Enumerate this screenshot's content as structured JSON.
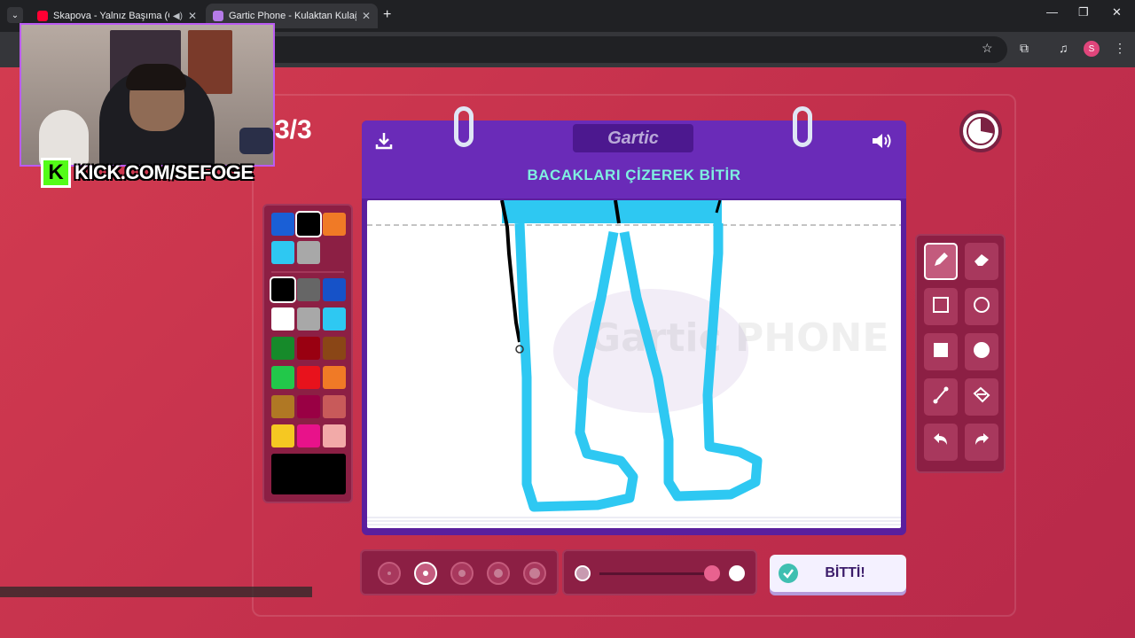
{
  "browser": {
    "tabs": [
      {
        "title": "Skapova - Yalnız Başıma (O",
        "active": false,
        "favicon_color": "#ff0033"
      },
      {
        "title": "Gartic Phone - Kulaktan Kulağa",
        "active": true,
        "favicon_color": "#b57be8"
      }
    ],
    "profile_initial": "S",
    "icons": [
      "tab-search-icon",
      "new-tab-icon",
      "minimize-icon",
      "restore-icon",
      "close-icon",
      "bookmark-star-icon",
      "extensions-icon",
      "media-control-icon",
      "menu-icon"
    ]
  },
  "stream": {
    "kick_badge": "KICK.COM/SEFOGE",
    "kick_logo": "K"
  },
  "game": {
    "round": "3/3",
    "logo": "Gartic",
    "instruction": "BACAKLARI ÇİZEREK BİTİR",
    "watermark": "Gartic PHONE",
    "done_label": "BİTTİ!",
    "timer_remaining_fraction": 0.72
  },
  "palette": {
    "recent": [
      "#1a5fd6",
      "#000000",
      "#f07a26",
      "#2ec8f2",
      "#a8a8a8"
    ],
    "selected_recent_index": 1,
    "colors": [
      "#000000",
      "#666666",
      "#1652c8",
      "#ffffff",
      "#a8a8a8",
      "#2ec8f2",
      "#168a2a",
      "#990011",
      "#8a4616",
      "#22c84a",
      "#e8121c",
      "#f07a26",
      "#b07824",
      "#990044",
      "#c85a5a",
      "#f5c822",
      "#e8128a",
      "#f2aaa8"
    ],
    "current": "#000000"
  },
  "tools": [
    {
      "name": "pencil",
      "selected": true
    },
    {
      "name": "eraser",
      "selected": false
    },
    {
      "name": "rectangle-outline",
      "selected": false
    },
    {
      "name": "ellipse-outline",
      "selected": false
    },
    {
      "name": "rectangle-fill",
      "selected": false
    },
    {
      "name": "ellipse-fill",
      "selected": false
    },
    {
      "name": "line",
      "selected": false
    },
    {
      "name": "bucket",
      "selected": false
    },
    {
      "name": "undo",
      "selected": false
    },
    {
      "name": "redo",
      "selected": false
    }
  ],
  "brush": {
    "sizes": [
      1,
      2,
      3,
      4,
      5
    ],
    "selected_size_index": 1,
    "opacity_level": 1.0
  }
}
